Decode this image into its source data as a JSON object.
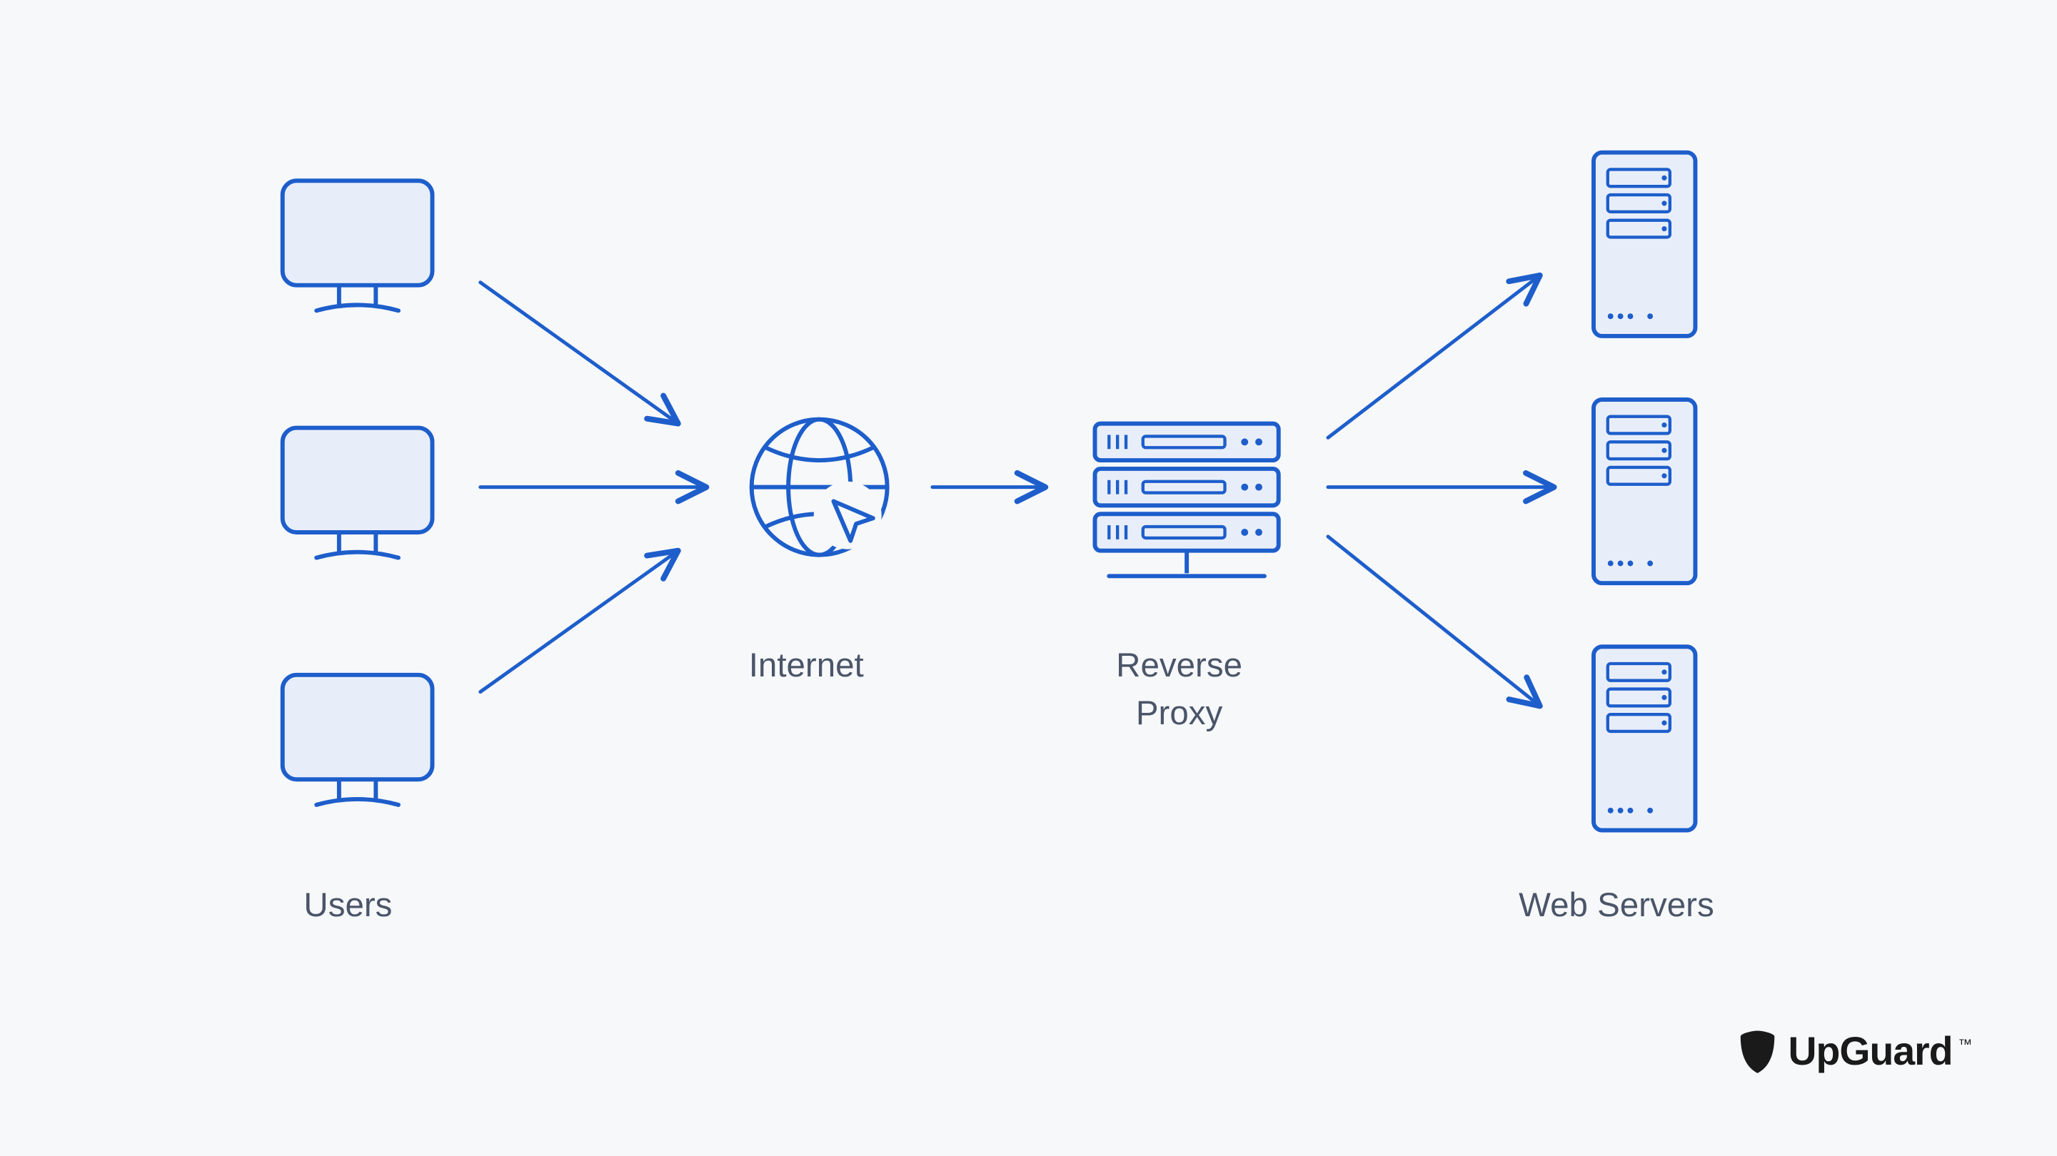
{
  "labels": {
    "users": "Users",
    "internet": "Internet",
    "reverse_proxy": "Reverse\nProxy",
    "web_servers": "Web Servers"
  },
  "brand": {
    "name": "UpGuard",
    "trademark": "™"
  },
  "colors": {
    "stroke": "#1d5ecb",
    "fill": "#e8eef9",
    "text": "#4a5568",
    "bg": "#f7f8fa",
    "logo": "#1a1a1a"
  },
  "diagram": {
    "nodes": [
      {
        "id": "user-1",
        "type": "monitor",
        "group": "users"
      },
      {
        "id": "user-2",
        "type": "monitor",
        "group": "users"
      },
      {
        "id": "user-3",
        "type": "monitor",
        "group": "users"
      },
      {
        "id": "internet",
        "type": "globe",
        "group": "internet"
      },
      {
        "id": "reverse-proxy",
        "type": "server-stack",
        "group": "reverse-proxy"
      },
      {
        "id": "server-1",
        "type": "tower",
        "group": "web-servers"
      },
      {
        "id": "server-2",
        "type": "tower",
        "group": "web-servers"
      },
      {
        "id": "server-3",
        "type": "tower",
        "group": "web-servers"
      }
    ],
    "edges": [
      {
        "from": "user-1",
        "to": "internet"
      },
      {
        "from": "user-2",
        "to": "internet"
      },
      {
        "from": "user-3",
        "to": "internet"
      },
      {
        "from": "internet",
        "to": "reverse-proxy"
      },
      {
        "from": "reverse-proxy",
        "to": "server-1"
      },
      {
        "from": "reverse-proxy",
        "to": "server-2"
      },
      {
        "from": "reverse-proxy",
        "to": "server-3"
      }
    ]
  }
}
